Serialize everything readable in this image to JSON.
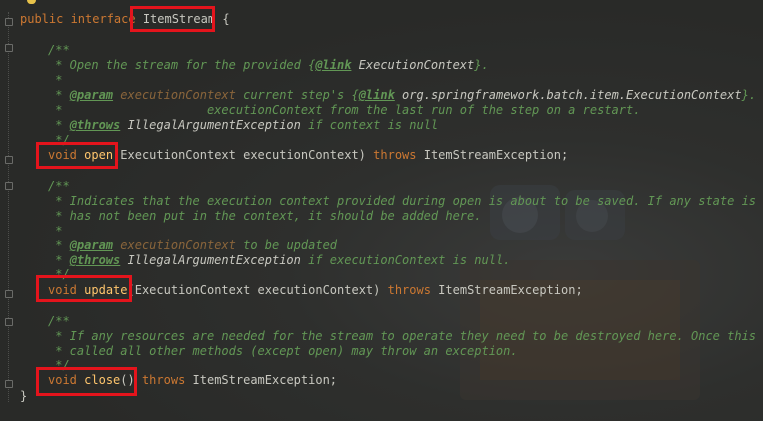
{
  "code": {
    "interface_decl": {
      "kw": "public interface",
      "name": "ItemStream",
      "brace": "{"
    },
    "open_doc": {
      "start": "/**",
      "l1_pre": " * Open the stream for the provided {",
      "l1_link": "@link",
      "l1_ref": " ExecutionContext",
      "l1_post": "}.",
      "blank": " *",
      "l3_pre": " * ",
      "l3_param": "@param",
      "l3_pname": " executionContext",
      "l3_txt": " current step's {",
      "l3_link": "@link",
      "l3_ref": " org.springframework.batch.item.ExecutionContext",
      "l3_post": "}.  Wi",
      "l4": " *                    executionContext from the last run of the step on a restart.",
      "l5_pre": " * ",
      "l5_throws": "@throws",
      "l5_exc": " IllegalArgumentException",
      "l5_txt": " if context is null",
      "end": " */"
    },
    "open_sig": {
      "ret": "void",
      "name": "open",
      "params": "(ExecutionContext executionContext) ",
      "throws": "throws",
      "exc": " ItemStreamException;"
    },
    "update_doc": {
      "start": "/**",
      "l1": " * Indicates that the execution context provided during open is about to be saved. If any state is rem",
      "l2": " * has not been put in the context, it should be added here.",
      "blank": " *",
      "l4_pre": " * ",
      "l4_param": "@param",
      "l4_pname": " executionContext",
      "l4_txt": " to be updated",
      "l5_pre": " * ",
      "l5_throws": "@throws",
      "l5_exc": " IllegalArgumentException",
      "l5_txt": " if executionContext is null.",
      "end": " */"
    },
    "update_sig": {
      "ret": "void",
      "name": "update",
      "params": "(ExecutionContext executionContext) ",
      "throws": "throws",
      "exc": " ItemStreamException;"
    },
    "close_doc": {
      "start": "/**",
      "l1": " * If any resources are needed for the stream to operate they need to be destroyed here. Once this met",
      "l2": " * called all other methods (except open) may throw an exception.",
      "end": " */"
    },
    "close_sig": {
      "ret": "void",
      "name": "close",
      "params": "() ",
      "throws": "throws",
      "exc": " ItemStreamException;"
    },
    "closing_brace": "}"
  },
  "colors": {
    "keyword": "#cc7832",
    "method": "#ffc66d",
    "javadoc": "#629755",
    "highlight_box": "#e4141c"
  },
  "icons": [
    "bulb-icon",
    "fold-icon"
  ]
}
